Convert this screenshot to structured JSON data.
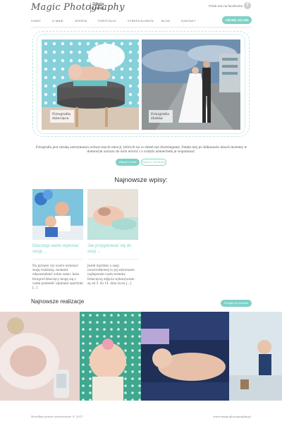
{
  "header": {
    "logo": "Magic Photography",
    "tagline_line1": "Zdjęcia",
    "tagline_line2": "z pasją",
    "facebook_text": "Polub nas na facebooku",
    "facebook_icon": "facebook-icon",
    "phone": "+48 601 111 001"
  },
  "nav": {
    "items": [
      "START",
      "O MNIE",
      "OFERTA",
      "PORTFOLIO",
      "STREFA KLIENTA",
      "BLOG",
      "KONTAKT"
    ]
  },
  "hero": {
    "left_caption_1": "Fotografia",
    "left_caption_2": "dziecięca",
    "right_caption_1": "Fotografia",
    "right_caption_2": "ślubna"
  },
  "intro": {
    "text": "Fotografia jest sztuką zatrzymania uchwyconych emocji, których na co dzień nie dostrzegamy. Dzięki niej po kilkunastu latach możemy w domowym zaciszu do nich wrócić i z czułym uśmiechem je wspominać.",
    "primary_button": "Więcej o mnie",
    "secondary_button": "Zapisz z terminem"
  },
  "posts_heading": "Najnowsze wpisy:",
  "posts": [
    {
      "title": "Dlaczego warto wykonać sesję ...",
      "excerpt": "Na pytanie czy warto wykonać sesję rodzinną, moment odpowiedzieć sobie samo: każa fotograf dziecięcy mogę się z wami podzielić opiniami opartymi [...]"
    },
    {
      "title": "Jak przygotować się do sesji ...",
      "excerpt": "Jeżeli myślimy o sesji noworodkowej to jej wykonanie najlepszym czym terminy. Dziecięcej zdjęcia wykonywane są od 5. do 14. dnia życia [...]"
    }
  ],
  "works": {
    "heading": "Najnowsze realizacje",
    "button": "Przejdź do portfolio"
  },
  "footer": {
    "left": "Wszelkie prawa zastrzeżone © 2017",
    "right": "www.magicphotography.pl"
  },
  "colors": {
    "accent": "#7fd1c7",
    "text": "#555555"
  }
}
